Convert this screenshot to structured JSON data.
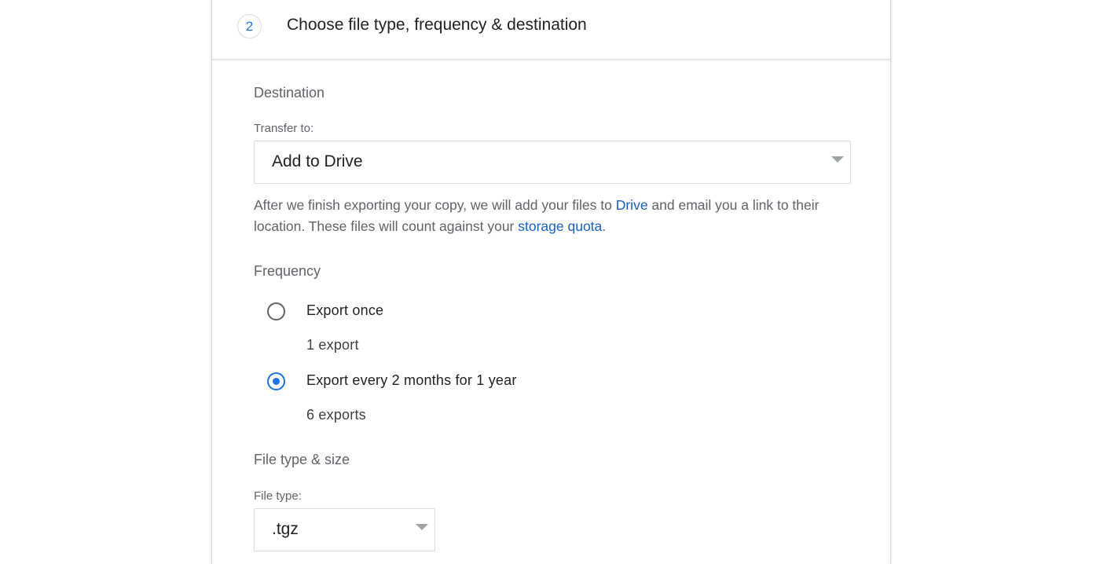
{
  "step": {
    "number": "2",
    "title": "Choose file type, frequency & destination"
  },
  "destination": {
    "heading": "Destination",
    "transfer_label": "Transfer to:",
    "transfer_value": "Add to Drive",
    "description_pre": "After we finish exporting your copy, we will add your files to ",
    "drive_link": "Drive",
    "description_mid": " and email you a link to their location. These files will count against your ",
    "quota_link": "storage quota",
    "description_post": "."
  },
  "frequency": {
    "heading": "Frequency",
    "options": [
      {
        "label": "Export once",
        "sub": "1 export",
        "selected": false
      },
      {
        "label": "Export every 2 months for 1 year",
        "sub": "6 exports",
        "selected": true
      }
    ]
  },
  "file_type": {
    "heading": "File type & size",
    "label": "File type:",
    "value": ".tgz"
  },
  "colors": {
    "accent": "#1a73e8",
    "link": "#1a5fc7",
    "border": "#dadce0"
  },
  "icons": {
    "dropdown": "caret-down-icon"
  }
}
